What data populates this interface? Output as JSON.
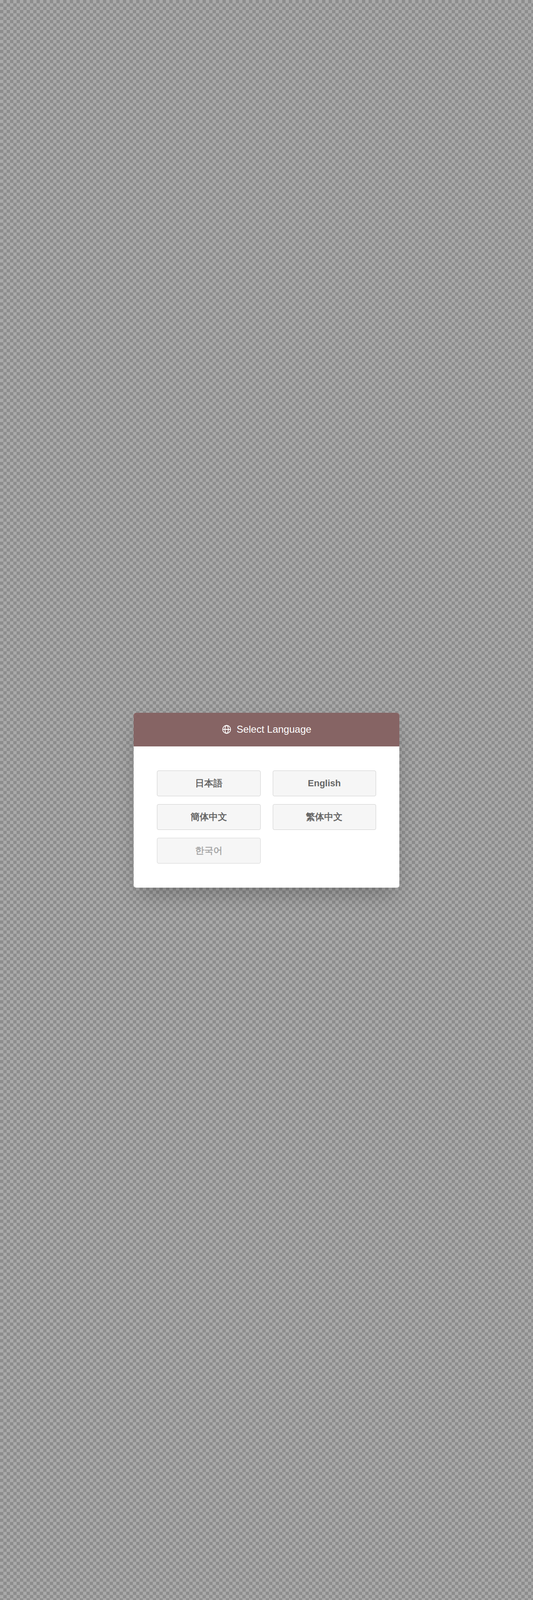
{
  "dialog": {
    "title": "Select Language",
    "options": [
      {
        "label": "日本語",
        "disabled": false
      },
      {
        "label": "English",
        "disabled": false
      },
      {
        "label": "簡体中文",
        "disabled": false
      },
      {
        "label": "繁体中文",
        "disabled": false
      },
      {
        "label": "한국어",
        "disabled": true
      }
    ]
  }
}
